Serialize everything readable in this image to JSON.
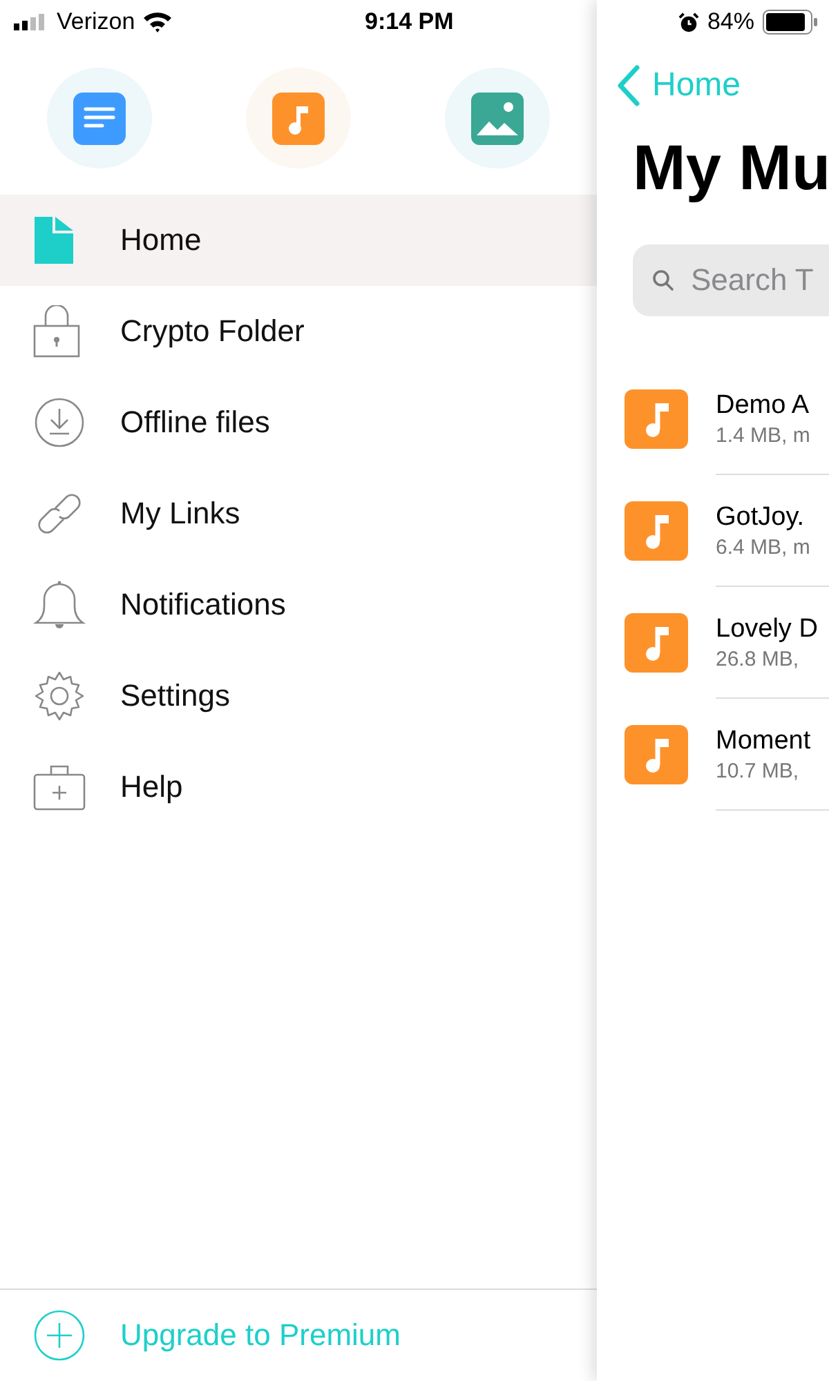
{
  "status_bar": {
    "carrier": "Verizon",
    "time": "9:14 PM",
    "battery": "84%"
  },
  "quick_actions": [
    {
      "kind": "documents"
    },
    {
      "kind": "music"
    },
    {
      "kind": "photos"
    }
  ],
  "menu": [
    {
      "label": "Home",
      "kind": "home",
      "selected": true
    },
    {
      "label": "Crypto Folder",
      "kind": "lock",
      "selected": false
    },
    {
      "label": "Offline files",
      "kind": "download",
      "selected": false
    },
    {
      "label": "My Links",
      "kind": "link",
      "selected": false
    },
    {
      "label": "Notifications",
      "kind": "bell",
      "selected": false
    },
    {
      "label": "Settings",
      "kind": "gear",
      "selected": false
    },
    {
      "label": "Help",
      "kind": "help",
      "selected": false
    }
  ],
  "upgrade": {
    "label": "Upgrade to Premium"
  },
  "panel": {
    "back": "Home",
    "title": "My Mu",
    "search": {
      "placeholder": "Search T"
    },
    "files": [
      {
        "name": "Demo A",
        "meta": "1.4 MB, m"
      },
      {
        "name": "GotJoy.",
        "meta": "6.4 MB, m"
      },
      {
        "name": "Lovely D",
        "meta": "26.8 MB,"
      },
      {
        "name": "Moment",
        "meta": "10.7 MB,"
      }
    ]
  }
}
